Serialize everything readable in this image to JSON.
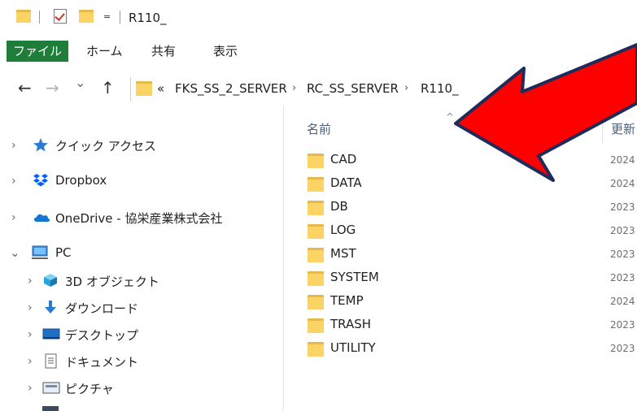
{
  "window": {
    "title": "R110_",
    "qa_dropdown": "="
  },
  "ribbon": {
    "tabs": [
      "ファイル",
      "ホーム",
      "共有",
      "表示"
    ]
  },
  "address": {
    "overflow": "«",
    "crumbs": [
      "FKS_SS_2_SERVER",
      "RC_SS_SERVER",
      "R110_"
    ],
    "separator": "›"
  },
  "navigation": {
    "back": "←",
    "forward": "→",
    "recent": "⌄",
    "up": "↑"
  },
  "nav_pane": {
    "items": [
      {
        "label": "クイック アクセス",
        "icon": "star-icon",
        "expanded": false
      },
      {
        "label": "Dropbox",
        "icon": "dropbox-icon",
        "expanded": false
      },
      {
        "label": "OneDrive - 協栄産業株式会社",
        "icon": "cloud-icon",
        "expanded": false
      },
      {
        "label": "PC",
        "icon": "computer-icon",
        "expanded": true
      },
      {
        "label": "3D オブジェクト",
        "icon": "3d-objects-icon",
        "expanded": false
      },
      {
        "label": "ダウンロード",
        "icon": "download-icon",
        "expanded": false
      },
      {
        "label": "デスクトップ",
        "icon": "desktop-icon",
        "expanded": false
      },
      {
        "label": "ドキュメント",
        "icon": "documents-icon",
        "expanded": false
      },
      {
        "label": "ピクチャ",
        "icon": "pictures-icon",
        "expanded": false
      }
    ]
  },
  "file_list": {
    "columns": {
      "name": "名前",
      "modified": "更新"
    },
    "rows": [
      {
        "name": "CAD",
        "modified": "2024"
      },
      {
        "name": "DATA",
        "modified": "2024"
      },
      {
        "name": "DB",
        "modified": "2023"
      },
      {
        "name": "LOG",
        "modified": "2023"
      },
      {
        "name": "MST",
        "modified": "2023"
      },
      {
        "name": "SYSTEM",
        "modified": "2023"
      },
      {
        "name": "TEMP",
        "modified": "2024"
      },
      {
        "name": "TRASH",
        "modified": "2023"
      },
      {
        "name": "UTILITY",
        "modified": "2023"
      }
    ]
  },
  "colors": {
    "file_tab": "#1e7d38",
    "folder": "#fcd365",
    "annotation_arrow": "#ff0000"
  }
}
